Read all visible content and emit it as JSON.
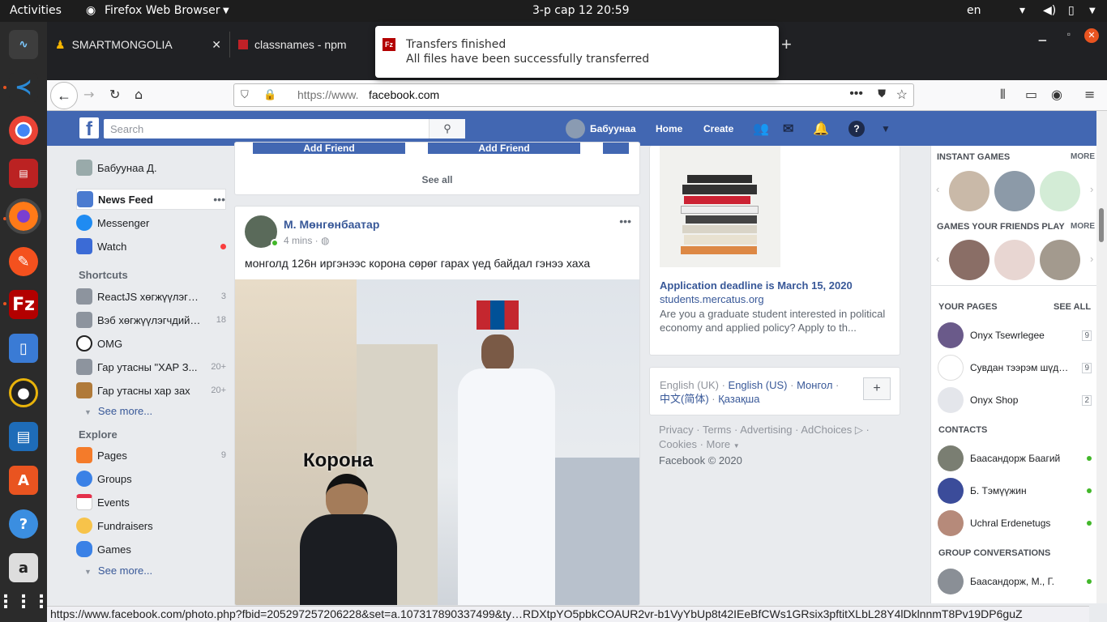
{
  "system": {
    "activities": "Activities",
    "app_menu": "Firefox Web Browser",
    "clock": "3-р сар 12  20:59",
    "lang": "en"
  },
  "notification": {
    "title": "Transfers finished",
    "body": "All files have been successfully transferred"
  },
  "tabs": [
    {
      "label": "SMARTMONGOLIA"
    },
    {
      "label": "classnames - npm"
    }
  ],
  "url": {
    "prefix": "https://www.",
    "domain": "facebook.com"
  },
  "fb": {
    "search_placeholder": "Search",
    "user_name": "Бабуунаа",
    "home": "Home",
    "create": "Create",
    "left": {
      "profile": "Бабуунаа Д.",
      "news_feed": "News Feed",
      "messenger": "Messenger",
      "watch": "Watch",
      "shortcuts_heading": "Shortcuts",
      "shortcuts": [
        {
          "label": "ReactJS хөгжүүлэгчид",
          "count": "3"
        },
        {
          "label": "Вэб хөгжүүлэгчдийн бүлэг",
          "count": "18"
        },
        {
          "label": "OMG",
          "count": ""
        },
        {
          "label": "Гар утасны \"ХАР З...",
          "count": "20+"
        },
        {
          "label": "Гар утасны хар зах",
          "count": "20+"
        }
      ],
      "see_more": "See more...",
      "explore_heading": "Explore",
      "explore": [
        {
          "label": "Pages",
          "count": "9"
        },
        {
          "label": "Groups",
          "count": ""
        },
        {
          "label": "Events",
          "count": ""
        },
        {
          "label": "Fundraisers",
          "count": ""
        },
        {
          "label": "Games",
          "count": ""
        }
      ],
      "see_more2": "See more..."
    },
    "feed": {
      "add_friend": "Add Friend",
      "see_all": "See all",
      "post": {
        "author": "М. Мөнгөнбаатар",
        "time": "4 mins",
        "text": "монголд 126н иргэнээс корона сөрөг гарах үед байдал гэнээ хаха",
        "image_caption": "Корона"
      }
    },
    "ad": {
      "title": "Application deadline is March 15, 2020",
      "domain": "students.mercatus.org",
      "body": "Are you a graduate student interested in political economy and applied policy? Apply to th..."
    },
    "langs": {
      "current": "English (UK)",
      "l1": "English (US)",
      "l2": "Монгол",
      "l3": "中文(简体)",
      "l4": "Қазақша",
      "plus": "+"
    },
    "footer": {
      "privacy": "Privacy",
      "terms": "Terms",
      "advertising": "Advertising",
      "adchoices": "AdChoices",
      "cookies": "Cookies",
      "more": "More",
      "copyright": "Facebook © 2020"
    },
    "right": {
      "instant_games": "INSTANT GAMES",
      "more": "MORE",
      "friends_games": "GAMES YOUR FRIENDS PLAY",
      "more2": "MORE",
      "your_pages": "YOUR PAGES",
      "see_all": "SEE ALL",
      "pages": [
        {
          "name": "Onyx Tsewrlegee",
          "count": "9"
        },
        {
          "name": "Сувдан тээрэм шүднийн",
          "count": "9"
        },
        {
          "name": "Onyx Shop",
          "count": "2"
        }
      ],
      "contacts": "CONTACTS",
      "people": [
        {
          "name": "Баасандорж Баагий"
        },
        {
          "name": "Б. Тэмүүжин"
        },
        {
          "name": "Uchral Erdenetugs"
        }
      ],
      "group_conv": "GROUP CONVERSATIONS",
      "group": "Баасандорж, М., Г."
    }
  },
  "status_url": "https://www.facebook.com/photo.php?fbid=205297257206228&set=a.107317890337499&ty…RDXtpYO5pbkCOAUR2vr-b1VyYbUp8t42IEeBfCWs1GRsix3pftitXLbL28Y4lDklnnmT8Pv19DP6guZ"
}
